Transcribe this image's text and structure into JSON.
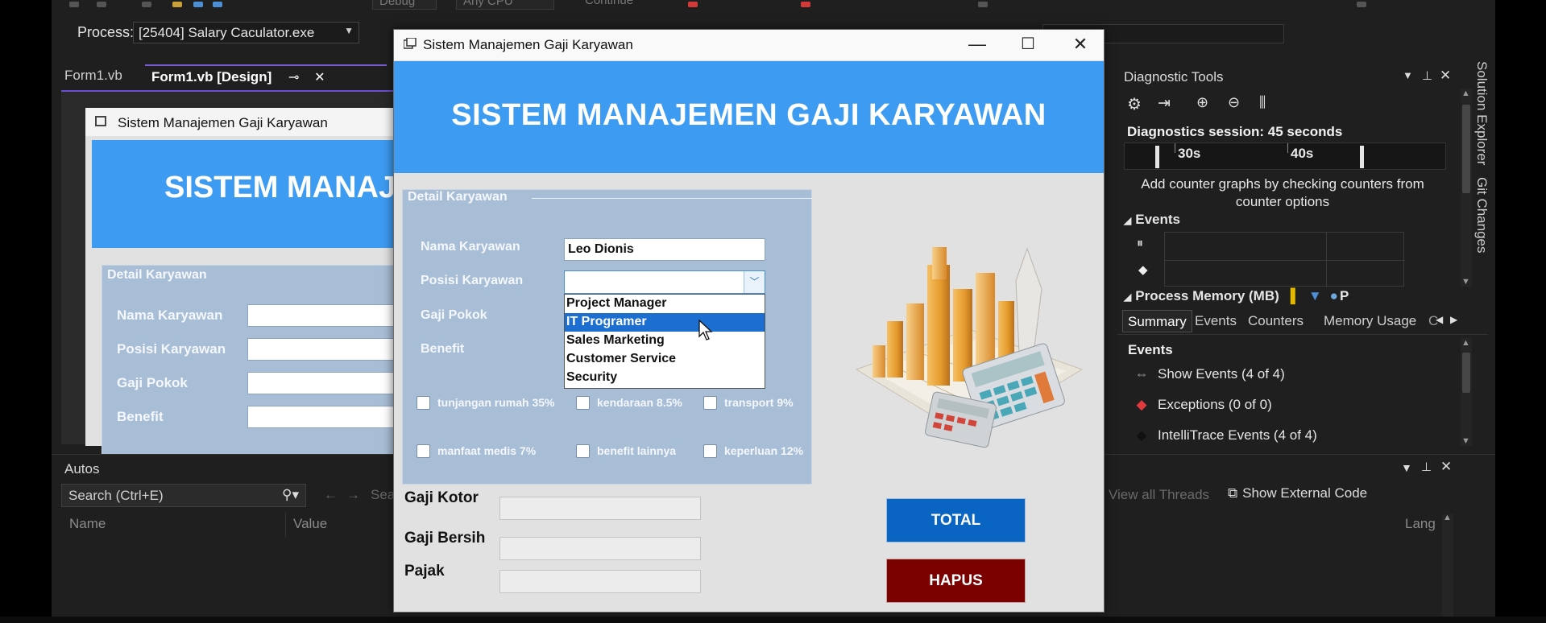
{
  "ide": {
    "toolbar": {
      "config": "Debug",
      "platform": "Any CPU",
      "continue": "Continue"
    },
    "process_label": "Process:",
    "process_value": "[25404] Salary Caculator.exe",
    "tabs": [
      {
        "label": "Form1.vb",
        "active": false
      },
      {
        "label": "Form1.vb [Design]",
        "active": true
      }
    ],
    "designer": {
      "form_title": "Sistem Manajemen Gaji Karyawan",
      "banner": "SISTEM MANAJE",
      "group_title": "Detail Karyawan",
      "labels": [
        "Nama Karyawan",
        "Posisi Karyawan",
        "Gaji Pokok",
        "Benefit"
      ]
    },
    "autos": {
      "title": "Autos",
      "search_placeholder": "Search (Ctrl+E)",
      "columns": [
        "Name",
        "Value"
      ],
      "search_depth_partial": "Sea",
      "right_links": [
        "View all Threads",
        "Show External Code"
      ],
      "lang_col": "Lang"
    },
    "diagnostics": {
      "title": "Diagnostic Tools",
      "session": "Diagnostics session: 45 seconds",
      "timeline_labels": [
        "30s",
        "40s"
      ],
      "hint": "Add counter graphs by checking counters from counter options",
      "events_header": "Events",
      "process_memory_header": "Process Memory (MB)",
      "process_memory_legend_partial": "P",
      "tabs": [
        "Summary",
        "Events",
        "Counters",
        "Memory Usage"
      ],
      "tabs_overflow_partial": "C",
      "active_tab": "Summary",
      "events_title": "Events",
      "events": [
        {
          "label": "Show Events (4 of 4)",
          "icon": "events-link-icon",
          "color": "#9a9a9a"
        },
        {
          "label": "Exceptions (0 of 0)",
          "icon": "exception-diamond-icon",
          "color": "#e0393e"
        },
        {
          "label": "IntelliTrace Events (4 of 4)",
          "icon": "intellitrace-diamond-icon",
          "color": "#111111"
        }
      ]
    },
    "side_tabs": [
      "Solution Explorer",
      "Git Changes"
    ]
  },
  "app": {
    "window_title": "Sistem Manajemen Gaji Karyawan",
    "banner_title": "SISTEM MANAJEMEN GAJI KARYAWAN",
    "group_title": "Detail Karyawan",
    "labels": {
      "nama": "Nama Karyawan",
      "posisi": "Posisi Karyawan",
      "gaji_pokok": "Gaji Pokok",
      "benefit": "Benefit"
    },
    "nama_value": "Leo Dionis",
    "posisi_value": "",
    "dropdown_options": [
      "Project Manager",
      "IT Programer",
      "Sales Marketing",
      "Customer Service",
      "Security"
    ],
    "dropdown_highlighted": "IT Programer",
    "checkboxes": [
      "tunjangan rumah 35%",
      "kendaraan 8.5%",
      "transport 9%",
      "manfaat medis 7%",
      "benefit lainnya",
      "keperluan 12%"
    ],
    "outputs": {
      "gaji_kotor": "Gaji Kotor",
      "gaji_bersih": "Gaji Bersih",
      "pajak": "Pajak"
    },
    "buttons": {
      "total": "TOTAL",
      "hapus": "HAPUS"
    },
    "colors": {
      "banner": "#3d9bf2",
      "group": "#a8bed6",
      "total_button": "#0a64c2",
      "hapus_button": "#7b0000",
      "selection": "#1c6ed1"
    }
  }
}
